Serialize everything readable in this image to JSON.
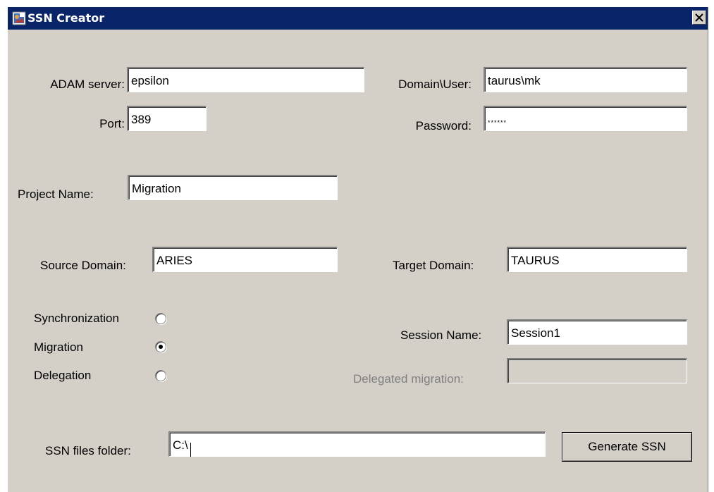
{
  "window": {
    "title": "SSN Creator",
    "icon": "app-icon",
    "close_icon": "close-icon"
  },
  "form": {
    "adam_server": {
      "label": "ADAM server:",
      "value": "epsilon"
    },
    "port": {
      "label": "Port:",
      "value": "389"
    },
    "domain_user": {
      "label": "Domain\\User:",
      "value": "taurus\\mk"
    },
    "password": {
      "label": "Password:",
      "value": "******"
    },
    "project_name": {
      "label": "Project Name:",
      "value": "Migration"
    },
    "source_domain": {
      "label": "Source Domain:",
      "value": "ARIES"
    },
    "target_domain": {
      "label": "Target Domain:",
      "value": "TAURUS"
    },
    "session_name": {
      "label": "Session Name:",
      "value": "Session1"
    },
    "delegated_migration": {
      "label": "Delegated migration:",
      "value": ""
    },
    "ssn_folder": {
      "label": "SSN files folder:",
      "value": "C:\\"
    }
  },
  "modes": {
    "options": [
      "Synchronization",
      "Migration",
      "Delegation"
    ],
    "selected": "Migration"
  },
  "buttons": {
    "generate": "Generate SSN"
  },
  "colors": {
    "titlebar": "#0a246a",
    "window_bg": "#d4d0c8",
    "disabled_text": "#808080"
  }
}
